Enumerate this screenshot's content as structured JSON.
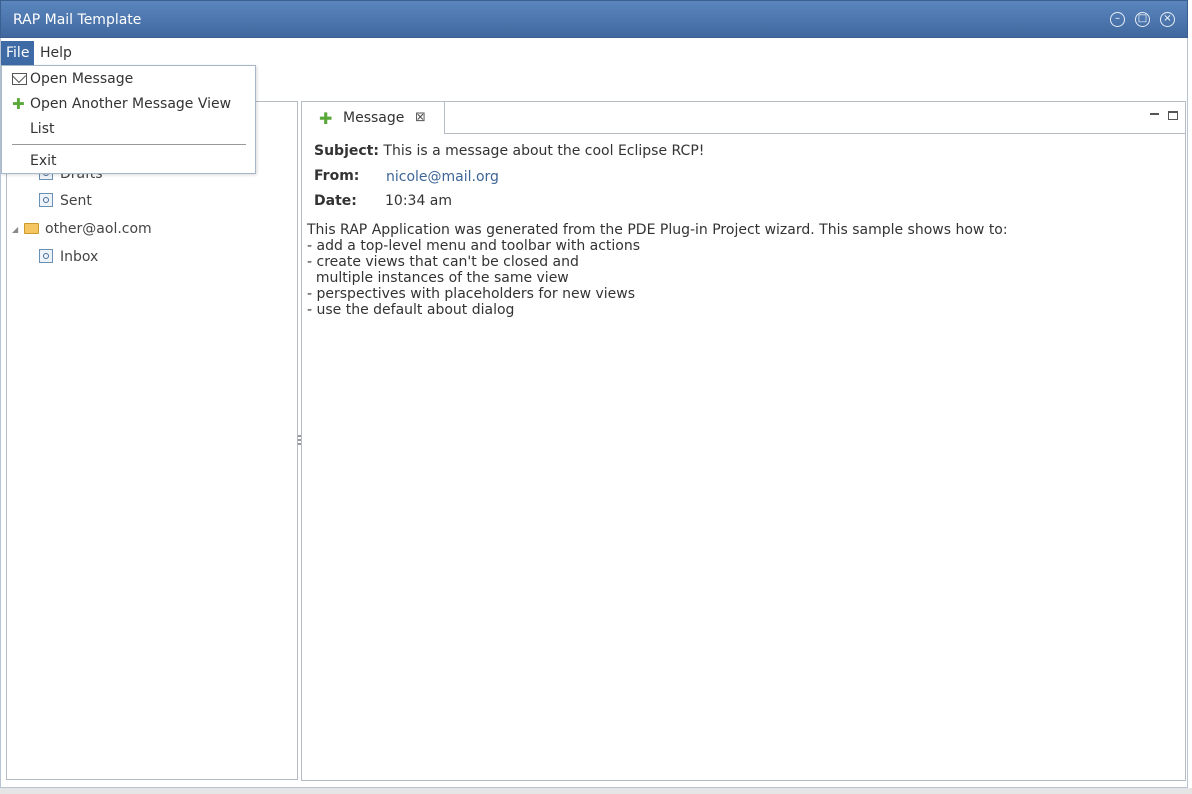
{
  "window": {
    "title": "RAP Mail Template",
    "controls": {
      "minimize": "–",
      "maximize": "□",
      "close": "×"
    }
  },
  "menubar": {
    "items": [
      "File",
      "Help"
    ],
    "active": "File"
  },
  "file_menu": {
    "items": [
      {
        "label": "Open Message",
        "icon": "envelope-icon"
      },
      {
        "label": "Open Another Message View",
        "icon": "plus-icon"
      },
      {
        "label": "List",
        "icon": ""
      },
      {
        "label": "Exit",
        "icon": ""
      }
    ]
  },
  "tree": {
    "items": [
      {
        "label": "Drafts",
        "type": "mailbox",
        "partially_hidden": true
      },
      {
        "label": "Sent",
        "type": "mailbox"
      },
      {
        "label": "other@aol.com",
        "type": "account",
        "expanded": true
      },
      {
        "label": "Inbox",
        "type": "mailbox"
      }
    ]
  },
  "editor_tab": {
    "label": "Message",
    "icon": "plus-icon",
    "close_glyph": "⊠"
  },
  "message": {
    "subject_label": "Subject:",
    "subject": "This is a message about the cool Eclipse RCP!",
    "from_label": "From:",
    "from": "nicole@mail.org",
    "date_label": "Date:",
    "date": "10:34 am",
    "body": "This RAP Application was generated from the PDE Plug-in Project wizard. This sample shows how to:\n- add a top-level menu and toolbar with actions\n- create views that can't be closed and\n  multiple instances of the same view\n- perspectives with placeholders for new views\n- use the default about dialog"
  },
  "colors": {
    "titlebar": "#4a74ab",
    "active_menu": "#3e6ba6",
    "link": "#3d6596"
  }
}
